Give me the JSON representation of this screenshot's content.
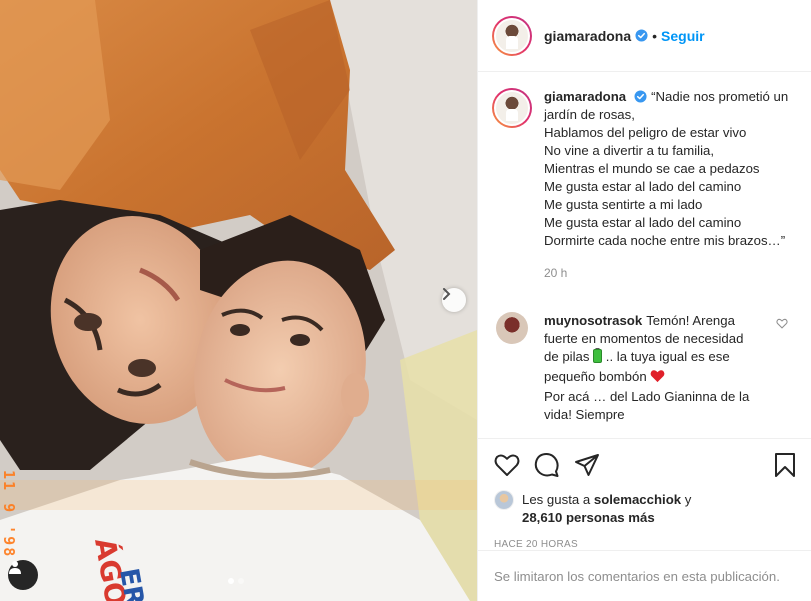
{
  "post": {
    "username": "giamaradona",
    "separator": "•",
    "follow_label": "Seguir"
  },
  "caption": {
    "username": "giamaradona",
    "text": "“Nadie nos prometió un jardín de rosas,\nHablamos del peligro de estar vivo\nNo vine a divertir a tu familia,\nMientras el mundo se cae a pedazos\nMe gusta estar al lado del camino\nMe gusta sentirte a mi lado\nMe gusta estar al lado del camino\nDormirte cada noche entre mis brazos…”",
    "time": "20 h"
  },
  "comment": {
    "username": "muynosotrasok",
    "text_part1": "Temón! Arenga fuerte en momentos de necesidad de pilas ",
    "text_part2": " .. la tuya igual es ese pequeño bombón ",
    "text_part3": "\nPor acá … del Lado Gianinna de la vida! Siempre"
  },
  "likes": {
    "prefix": "Les gusta a",
    "user": "solemacchiok",
    "conjunction": "y",
    "count": "28,610 personas más"
  },
  "post_date": "HACE 20 HORAS",
  "comments_disabled": "Se limitaron los comentarios en esta publicación.",
  "photo_overlay": {
    "timestamp": "11 9 '98"
  },
  "carousel": {
    "total": 2,
    "active": 1
  },
  "colors": {
    "accent": "#0095f6",
    "verified": "#3897f0",
    "heart_red": "#ed4956",
    "battery_green": "#3fbf3f",
    "timestamp_orange": "#ff7a1a",
    "text": "#262626",
    "muted": "#8e8e8e"
  },
  "icons": [
    "verified-badge-icon",
    "chevron-right-icon",
    "person-icon",
    "heart-icon",
    "comment-icon",
    "share-icon",
    "bookmark-icon",
    "battery-emoji",
    "red-heart-emoji"
  ]
}
